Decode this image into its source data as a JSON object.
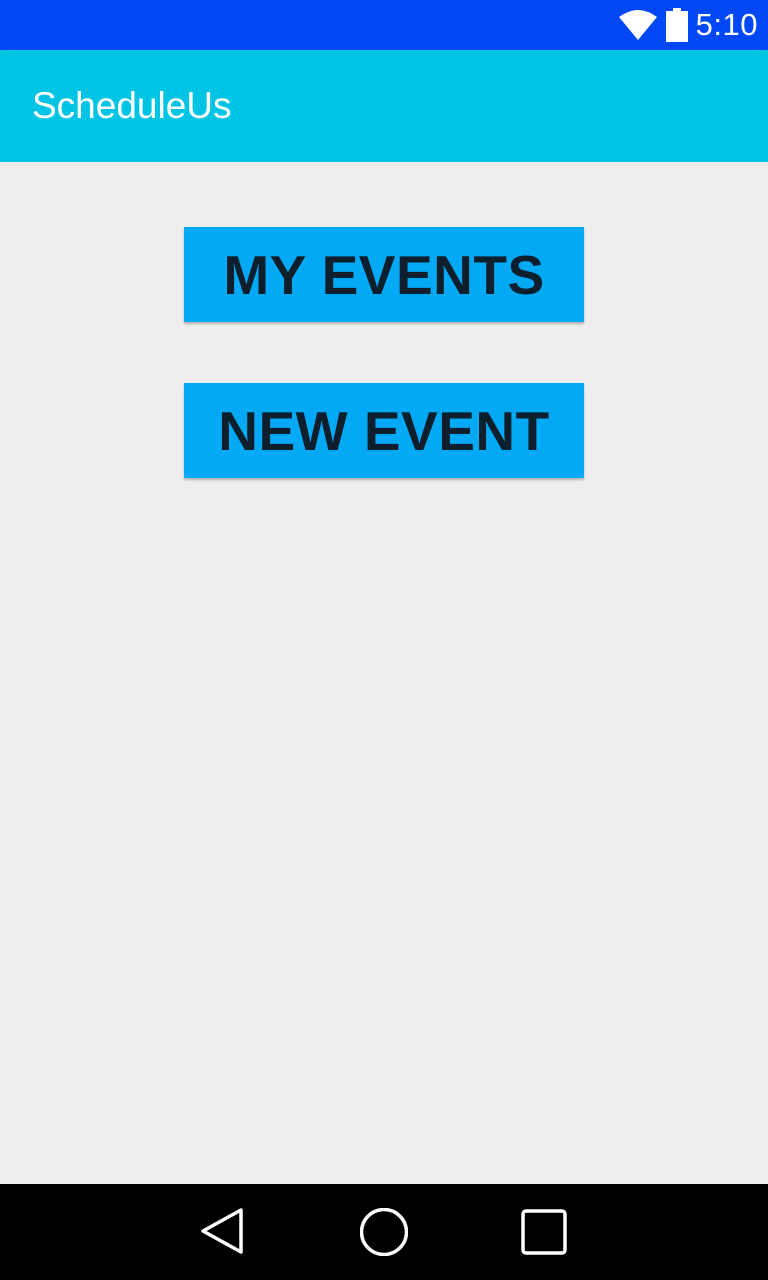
{
  "status_bar": {
    "time": "5:10",
    "wifi_icon": "wifi-icon",
    "battery_icon": "battery-icon",
    "background": "#0047f5"
  },
  "app_bar": {
    "title": "ScheduleUs",
    "background": "#00c4e3"
  },
  "main": {
    "buttons": [
      {
        "label": "MY EVENTS",
        "color": "#03a9f4"
      },
      {
        "label": "NEW EVENT",
        "color": "#03a9f4"
      }
    ],
    "background": "#eeeeee"
  },
  "nav_bar": {
    "back_icon": "back-triangle-icon",
    "home_icon": "home-circle-icon",
    "recents_icon": "recents-square-icon",
    "background": "#000000"
  }
}
